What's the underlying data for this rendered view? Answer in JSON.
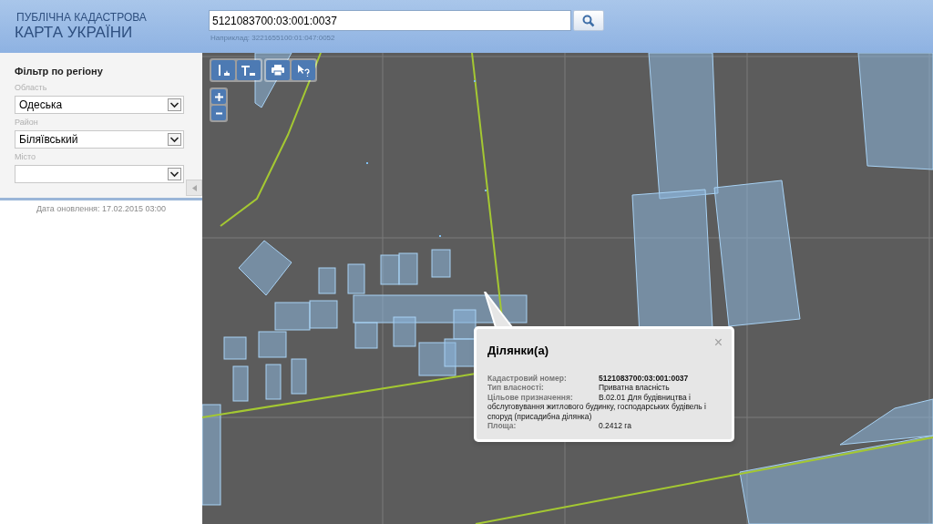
{
  "header": {
    "title_top": "ПУБЛІЧНА КАДАСТРОВА",
    "title_bottom": "КАРТА УКРАЇНИ"
  },
  "search": {
    "value": "5121083700:03:001:0037",
    "example": "Наприклад: 3221655100:01:047:0052"
  },
  "filter": {
    "title": "Фільтр по регіону",
    "fields": [
      {
        "label": "Область",
        "value": "Одеська"
      },
      {
        "label": "Район",
        "value": "Біляївський"
      },
      {
        "label": "Місто"
      }
    ],
    "update_date": "Дата оновлення: 17.02.2015 03:00"
  },
  "popup": {
    "title": "Ділянки(а)",
    "close": "×",
    "rows": [
      {
        "label": "Кадастровий номер:",
        "value": "5121083700:03:001:0037",
        "bold": true
      },
      {
        "label": "Тип власності:",
        "value": "Приватна власність",
        "bold": false
      },
      {
        "label": "Цільове призначення:",
        "value": "В.02.01 Для будівництва і обслуговування житлового будинку, господарських будівель і споруд (присадибна ділянка)",
        "bold": false
      },
      {
        "label": "Площа:",
        "value": "0.2412 га",
        "bold": false
      }
    ]
  }
}
